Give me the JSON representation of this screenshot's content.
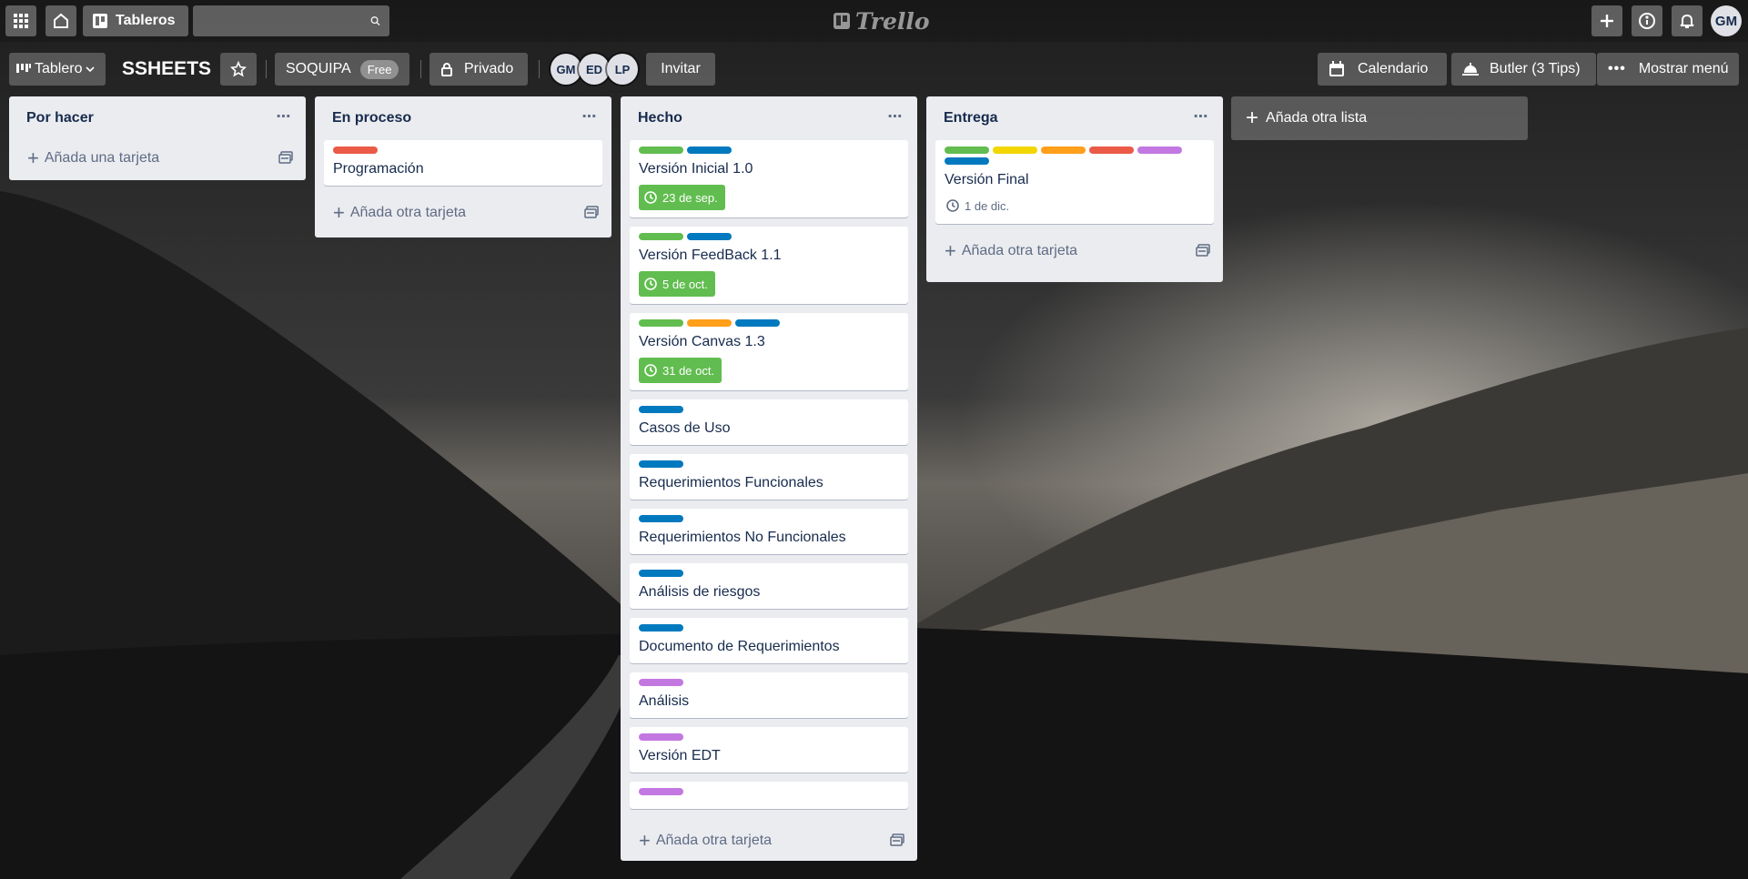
{
  "header": {
    "boards_label": "Tableros",
    "search_placeholder": "",
    "logo_text": "Trello",
    "user_initials": "GM"
  },
  "board_bar": {
    "view_label": "Tablero",
    "board_title": "SSHEETS",
    "team_name": "SOQUIPA",
    "team_plan": "Free",
    "visibility_label": "Privado",
    "members": [
      "GM",
      "ED",
      "LP"
    ],
    "invite_label": "Invitar",
    "calendar_label": "Calendario",
    "butler_label": "Butler (3 Tips)",
    "menu_label": "Mostrar menú"
  },
  "colors": {
    "green": "#61bd4f",
    "yellow": "#f2d600",
    "orange": "#ff9f1a",
    "red": "#eb5a46",
    "purple": "#c377e0",
    "blue": "#0079bf"
  },
  "lists": [
    {
      "title": "Por hacer",
      "cards": [],
      "add_label": "Añada una tarjeta"
    },
    {
      "title": "En proceso",
      "cards": [
        {
          "title": "Programación",
          "labels": [
            "red"
          ]
        }
      ],
      "add_label": "Añada otra tarjeta"
    },
    {
      "title": "Hecho",
      "cards": [
        {
          "title": "Versión Inicial 1.0",
          "labels": [
            "green",
            "blue"
          ],
          "due": "23 de sep.",
          "due_done": true
        },
        {
          "title": "Versión FeedBack 1.1",
          "labels": [
            "green",
            "blue"
          ],
          "due": "5 de oct.",
          "due_done": true
        },
        {
          "title": "Versión Canvas 1.3",
          "labels": [
            "green",
            "orange",
            "blue"
          ],
          "due": "31 de oct.",
          "due_done": true
        },
        {
          "title": "Casos de Uso",
          "labels": [
            "blue"
          ]
        },
        {
          "title": "Requerimientos Funcionales",
          "labels": [
            "blue"
          ]
        },
        {
          "title": "Requerimientos No Funcionales",
          "labels": [
            "blue"
          ]
        },
        {
          "title": "Análisis de riesgos",
          "labels": [
            "blue"
          ]
        },
        {
          "title": "Documento de Requerimientos",
          "labels": [
            "blue"
          ]
        },
        {
          "title": "Análisis",
          "labels": [
            "purple"
          ]
        },
        {
          "title": "Versión EDT",
          "labels": [
            "purple"
          ]
        },
        {
          "title": "",
          "labels": [
            "purple"
          ]
        }
      ],
      "add_label": "Añada otra tarjeta"
    },
    {
      "title": "Entrega",
      "cards": [
        {
          "title": "Versión Final",
          "labels": [
            "green",
            "yellow",
            "orange",
            "red",
            "purple",
            "blue"
          ],
          "due": "1 de dic.",
          "due_done": false
        }
      ],
      "add_label": "Añada otra tarjeta"
    }
  ],
  "add_list_label": "Añada otra lista"
}
